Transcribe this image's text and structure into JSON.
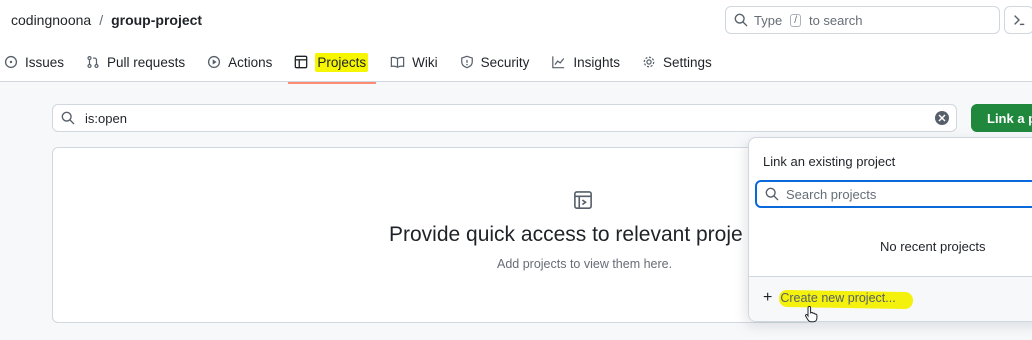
{
  "breadcrumb": {
    "owner": "codingnoona",
    "separator": "/",
    "repo": "group-project"
  },
  "global_search": {
    "prefix": "Type",
    "key": "/",
    "suffix": "to search"
  },
  "tabs": [
    {
      "label": "Issues",
      "icon": "issue-circle-icon"
    },
    {
      "label": "Pull requests",
      "icon": "pull-request-icon"
    },
    {
      "label": "Actions",
      "icon": "play-circle-icon"
    },
    {
      "label": "Projects",
      "icon": "table-icon",
      "active": true
    },
    {
      "label": "Wiki",
      "icon": "book-icon"
    },
    {
      "label": "Security",
      "icon": "shield-icon"
    },
    {
      "label": "Insights",
      "icon": "graph-icon"
    },
    {
      "label": "Settings",
      "icon": "gear-icon"
    }
  ],
  "filter": {
    "value": "is:open"
  },
  "link_button": {
    "label": "Link a pr"
  },
  "blankslate": {
    "title": "Provide quick access to relevant proje",
    "description": "Add projects to view them here."
  },
  "popover": {
    "title": "Link an existing project",
    "search_placeholder": "Search projects",
    "empty_text": "No recent projects",
    "create_label": "Create new project..."
  },
  "colors": {
    "primary_button": "#1f883d",
    "active_tab_underline": "#fd8c73",
    "focus_border": "#0969da",
    "highlight": "#f6f600"
  }
}
